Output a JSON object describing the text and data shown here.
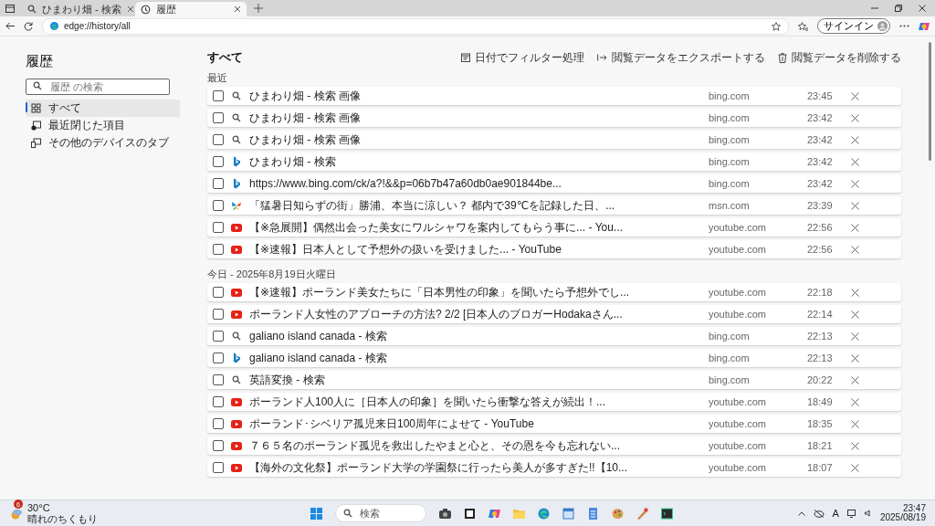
{
  "tabs": [
    {
      "title": "ひまわり畑 - 検索",
      "kind": "search",
      "selected": false
    },
    {
      "title": "履歴",
      "kind": "history",
      "selected": true
    }
  ],
  "toolbar": {
    "address": "edge://history/all",
    "signin": "サインイン"
  },
  "sidebar": {
    "title": "履歴",
    "search": {
      "placeholder": "履歴 の検索"
    },
    "items": [
      {
        "label": "すべて",
        "selected": true
      },
      {
        "label": "最近閉じた項目",
        "selected": false
      },
      {
        "label": "その他のデバイスのタブ",
        "selected": false
      }
    ]
  },
  "main": {
    "title": "すべて",
    "actions": [
      "日付でフィルター処理",
      "閲覧データをエクスポートする",
      "閲覧データを削除する"
    ],
    "groups": [
      {
        "heading": "最近",
        "entries": [
          {
            "kind": "search",
            "title": "ひまわり畑 - 検索 画像",
            "site": "bing.com",
            "time": "23:45",
            "checked": false
          },
          {
            "kind": "search",
            "title": "ひまわり畑 - 検索 画像",
            "site": "bing.com",
            "time": "23:42",
            "checked": false
          },
          {
            "kind": "search",
            "title": "ひまわり畑 - 検索 画像",
            "site": "bing.com",
            "time": "23:42",
            "checked": false
          },
          {
            "kind": "bing",
            "title": "ひまわり畑 - 検索",
            "site": "bing.com",
            "time": "23:42",
            "checked": false
          },
          {
            "kind": "bing",
            "title": "https://www.bing.com/ck/a?!&&p=06b7b47a60db0ae901844be...",
            "site": "bing.com",
            "time": "23:42",
            "checked": false
          },
          {
            "kind": "msn",
            "title": "「猛暑日知らずの街」勝浦、本当に涼しい？ 都内で39℃を記録した日、...",
            "site": "msn.com",
            "time": "23:39",
            "checked": false
          },
          {
            "kind": "youtube",
            "title": "【※急展開】偶然出会った美女にワルシャワを案内してもらう事に... - You...",
            "site": "youtube.com",
            "time": "22:56",
            "checked": false
          },
          {
            "kind": "youtube",
            "title": "【※速報】日本人として予想外の扱いを受けました... - YouTube",
            "site": "youtube.com",
            "time": "22:56",
            "checked": false
          }
        ]
      },
      {
        "heading": "今日 - 2025年8月19日火曜日",
        "entries": [
          {
            "kind": "youtube",
            "title": "【※速報】ポーランド美女たちに「日本男性の印象」を聞いたら予想外でし...",
            "site": "youtube.com",
            "time": "22:18",
            "checked": false
          },
          {
            "kind": "youtube",
            "title": "ポーランド人女性のアプローチの方法? 2/2 [日本人のブロガーHodakaさん...",
            "site": "youtube.com",
            "time": "22:14",
            "checked": false
          },
          {
            "kind": "search",
            "title": "galiano island canada - 検索",
            "site": "bing.com",
            "time": "22:13",
            "checked": false
          },
          {
            "kind": "bing",
            "title": "galiano island canada - 検索",
            "site": "bing.com",
            "time": "22:13",
            "checked": false
          },
          {
            "kind": "search",
            "title": "英語変換 - 検索",
            "site": "bing.com",
            "time": "20:22",
            "checked": false
          },
          {
            "kind": "youtube",
            "title": "ポーランド人100人に［日本人の印象］を聞いたら衝撃な答えが続出！...",
            "site": "youtube.com",
            "time": "18:49",
            "checked": false
          },
          {
            "kind": "youtube",
            "title": "ポーランド･シベリア孤児来日100周年によせて - YouTube",
            "site": "youtube.com",
            "time": "18:35",
            "checked": false
          },
          {
            "kind": "youtube",
            "title": "７６５名のポーランド孤児を救出したやまと心と、その恩を今も忘れない...",
            "site": "youtube.com",
            "time": "18:21",
            "checked": false
          },
          {
            "kind": "youtube",
            "title": "【海外の文化祭】ポーランド大学の学園祭に行ったら美人が多すぎた!!【10...",
            "site": "youtube.com",
            "time": "18:07",
            "checked": false
          }
        ]
      }
    ]
  },
  "taskbar": {
    "badge": "6",
    "temperature": "30°C",
    "weather": "晴れのちくもり",
    "search": {
      "placeholder": "検索"
    },
    "ime": "A",
    "time": "23:47",
    "date": "2025/08/19"
  }
}
